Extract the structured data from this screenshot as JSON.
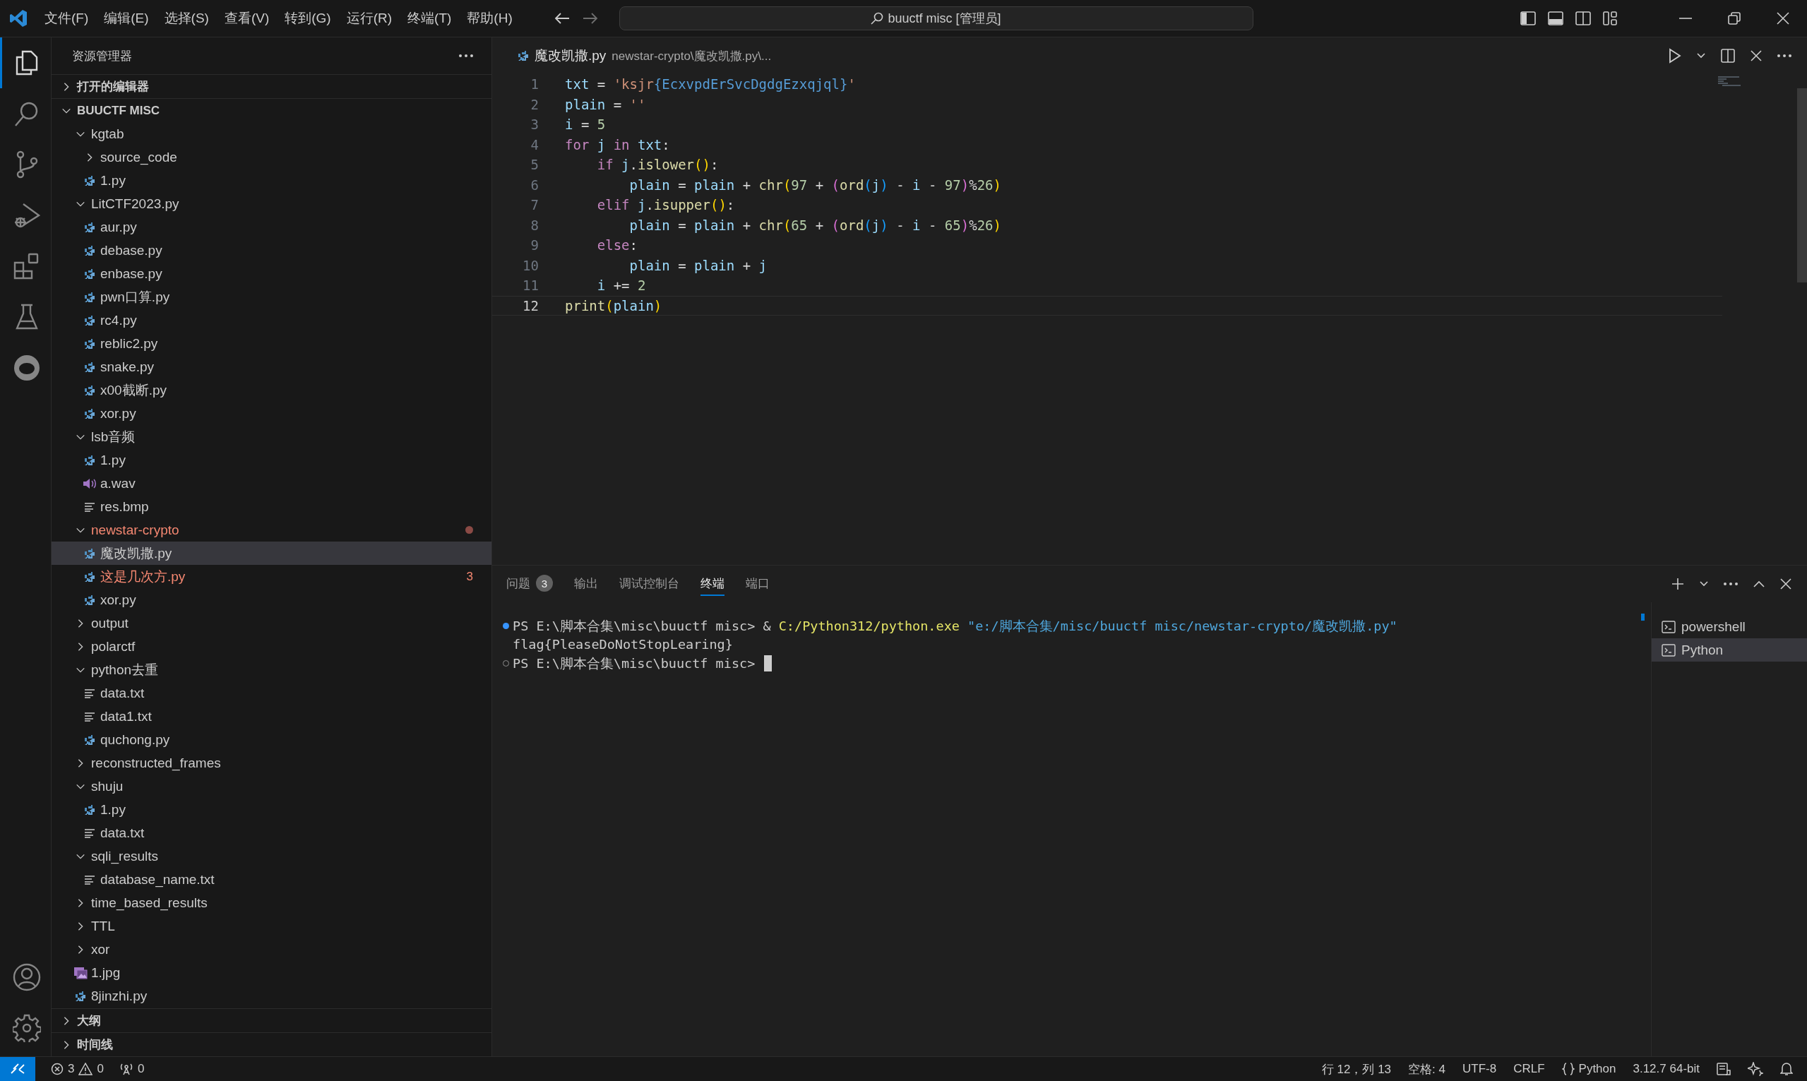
{
  "title_bar": {
    "menus": [
      "文件(F)",
      "编辑(E)",
      "选择(S)",
      "查看(V)",
      "转到(G)",
      "运行(R)",
      "终端(T)",
      "帮助(H)"
    ],
    "search": "buuctf misc [管理员]"
  },
  "activity_bar": {
    "items": [
      {
        "kind": "explorer",
        "selected": true
      },
      {
        "kind": "search",
        "selected": false
      },
      {
        "kind": "source-control",
        "selected": false
      },
      {
        "kind": "run-debug",
        "selected": false
      },
      {
        "kind": "extensions",
        "selected": false
      },
      {
        "kind": "testing",
        "selected": false
      },
      {
        "kind": "extension-logo",
        "selected": false
      }
    ],
    "bottom": [
      {
        "kind": "account"
      },
      {
        "kind": "settings"
      }
    ]
  },
  "sidebar": {
    "title": "资源管理器",
    "sections": [
      {
        "label": "打开的编辑器",
        "expanded": false
      },
      {
        "label": "BUUCTF MISC",
        "expanded": true,
        "tree": [
          {
            "name": "kgtab",
            "kind": "folder",
            "expanded": true,
            "selected": false,
            "error": false,
            "children": [
              {
                "name": "source_code",
                "kind": "folder",
                "expanded": false,
                "selected": false,
                "error": false
              },
              {
                "name": "1.py",
                "kind": "python",
                "selected": false,
                "error": false
              }
            ]
          },
          {
            "name": "LitCTF2023.py",
            "kind": "folder",
            "expanded": true,
            "selected": false,
            "error": false,
            "children": [
              {
                "name": "aur.py",
                "kind": "python",
                "selected": false,
                "error": false
              },
              {
                "name": "debase.py",
                "kind": "python",
                "selected": false,
                "error": false
              },
              {
                "name": "enbase.py",
                "kind": "python",
                "selected": false,
                "error": false
              },
              {
                "name": "pwn口算.py",
                "kind": "python",
                "selected": false,
                "error": false
              },
              {
                "name": "rc4.py",
                "kind": "python",
                "selected": false,
                "error": false
              },
              {
                "name": "reblic2.py",
                "kind": "python",
                "selected": false,
                "error": false
              },
              {
                "name": "snake.py",
                "kind": "python",
                "selected": false,
                "error": false
              },
              {
                "name": "x00截断.py",
                "kind": "python",
                "selected": false,
                "error": false
              },
              {
                "name": "xor.py",
                "kind": "python",
                "selected": false,
                "error": false
              }
            ]
          },
          {
            "name": "lsb音频",
            "kind": "folder",
            "expanded": true,
            "selected": false,
            "error": false,
            "children": [
              {
                "name": "1.py",
                "kind": "python",
                "selected": false,
                "error": false
              },
              {
                "name": "a.wav",
                "kind": "audio",
                "selected": false,
                "error": false
              },
              {
                "name": "res.bmp",
                "kind": "text",
                "selected": false,
                "error": false
              }
            ]
          },
          {
            "name": "newstar-crypto",
            "kind": "folder",
            "expanded": true,
            "selected": false,
            "error": true,
            "children": [
              {
                "name": "魔改凯撒.py",
                "kind": "python",
                "selected": true,
                "error": false
              },
              {
                "name": "这是几次方.py",
                "kind": "python",
                "selected": false,
                "error": true,
                "problems": "3"
              },
              {
                "name": "xor.py",
                "kind": "python",
                "selected": false,
                "error": false
              }
            ]
          },
          {
            "name": "output",
            "kind": "folder",
            "expanded": false,
            "selected": false,
            "error": false
          },
          {
            "name": "polarctf",
            "kind": "folder",
            "expanded": false,
            "selected": false,
            "error": false
          },
          {
            "name": "python去重",
            "kind": "folder",
            "expanded": true,
            "selected": false,
            "error": false,
            "children": [
              {
                "name": "data.txt",
                "kind": "text",
                "selected": false,
                "error": false
              },
              {
                "name": "data1.txt",
                "kind": "text",
                "selected": false,
                "error": false
              },
              {
                "name": "quchong.py",
                "kind": "python",
                "selected": false,
                "error": false
              }
            ]
          },
          {
            "name": "reconstructed_frames",
            "kind": "folder",
            "expanded": false,
            "selected": false,
            "error": false
          },
          {
            "name": "shuju",
            "kind": "folder",
            "expanded": true,
            "selected": false,
            "error": false,
            "children": [
              {
                "name": "1.py",
                "kind": "python",
                "selected": false,
                "error": false
              },
              {
                "name": "data.txt",
                "kind": "text",
                "selected": false,
                "error": false
              }
            ]
          },
          {
            "name": "sqli_results",
            "kind": "folder",
            "expanded": true,
            "selected": false,
            "error": false,
            "children": [
              {
                "name": "database_name.txt",
                "kind": "text",
                "selected": false,
                "error": false
              }
            ]
          },
          {
            "name": "time_based_results",
            "kind": "folder",
            "expanded": false,
            "selected": false,
            "error": false
          },
          {
            "name": "TTL",
            "kind": "folder",
            "expanded": false,
            "selected": false,
            "error": false
          },
          {
            "name": "xor",
            "kind": "folder",
            "expanded": false,
            "selected": false,
            "error": false
          },
          {
            "name": "1.jpg",
            "kind": "image",
            "selected": false,
            "error": false
          },
          {
            "name": "8jinzhi.py",
            "kind": "python",
            "selected": false,
            "error": false
          }
        ]
      },
      {
        "label": "大纲",
        "expanded": false
      },
      {
        "label": "时间线",
        "expanded": false
      }
    ]
  },
  "editor": {
    "tab": {
      "file": "魔改凯撒.py",
      "path": "newstar-crypto\\魔改凯撒.py\\..."
    },
    "lines": [
      {
        "number": "1",
        "current": false,
        "tokens": [
          {
            "text": "txt",
            "kind": "var"
          },
          {
            "text": " = ",
            "kind": "op"
          },
          {
            "text": "'ksjr",
            "kind": "str"
          },
          {
            "text": "{EcxvpdErSvcDgdgEzxqjql}",
            "kind": "interp"
          },
          {
            "text": "'",
            "kind": "str"
          }
        ]
      },
      {
        "number": "2",
        "current": false,
        "tokens": [
          {
            "text": "plain",
            "kind": "var"
          },
          {
            "text": " = ",
            "kind": "op"
          },
          {
            "text": "''",
            "kind": "str"
          }
        ]
      },
      {
        "number": "3",
        "current": false,
        "tokens": [
          {
            "text": "i",
            "kind": "var"
          },
          {
            "text": " = ",
            "kind": "op"
          },
          {
            "text": "5",
            "kind": "num"
          }
        ]
      },
      {
        "number": "4",
        "current": false,
        "tokens": [
          {
            "text": "for",
            "kind": "kw"
          },
          {
            "text": " j",
            "kind": "var"
          },
          {
            "text": " in",
            "kind": "kw"
          },
          {
            "text": " txt",
            "kind": "var"
          },
          {
            "text": ":",
            "kind": "op"
          }
        ]
      },
      {
        "number": "5",
        "current": false,
        "tokens": [
          {
            "text": "    if",
            "kind": "kw"
          },
          {
            "text": " j",
            "kind": "var"
          },
          {
            "text": ".",
            "kind": "op"
          },
          {
            "text": "islower",
            "kind": "func"
          },
          {
            "text": "()",
            "kind": "p1"
          },
          {
            "text": ":",
            "kind": "op"
          }
        ]
      },
      {
        "number": "6",
        "current": false,
        "tokens": [
          {
            "text": "        plain",
            "kind": "var"
          },
          {
            "text": " = ",
            "kind": "op"
          },
          {
            "text": "plain",
            "kind": "var"
          },
          {
            "text": " + ",
            "kind": "op"
          },
          {
            "text": "chr",
            "kind": "func"
          },
          {
            "text": "(",
            "kind": "p1"
          },
          {
            "text": "97",
            "kind": "num"
          },
          {
            "text": " + ",
            "kind": "op"
          },
          {
            "text": "(",
            "kind": "p2"
          },
          {
            "text": "ord",
            "kind": "func"
          },
          {
            "text": "(",
            "kind": "p3"
          },
          {
            "text": "j",
            "kind": "var"
          },
          {
            "text": ")",
            "kind": "p3"
          },
          {
            "text": " - ",
            "kind": "op"
          },
          {
            "text": "i",
            "kind": "var"
          },
          {
            "text": " - ",
            "kind": "op"
          },
          {
            "text": "97",
            "kind": "num"
          },
          {
            "text": ")",
            "kind": "p2"
          },
          {
            "text": "%",
            "kind": "op"
          },
          {
            "text": "26",
            "kind": "num"
          },
          {
            "text": ")",
            "kind": "p1"
          }
        ]
      },
      {
        "number": "7",
        "current": false,
        "tokens": [
          {
            "text": "    elif",
            "kind": "kw"
          },
          {
            "text": " j",
            "kind": "var"
          },
          {
            "text": ".",
            "kind": "op"
          },
          {
            "text": "isupper",
            "kind": "func"
          },
          {
            "text": "()",
            "kind": "p1"
          },
          {
            "text": ":",
            "kind": "op"
          }
        ]
      },
      {
        "number": "8",
        "current": false,
        "tokens": [
          {
            "text": "        plain",
            "kind": "var"
          },
          {
            "text": " = ",
            "kind": "op"
          },
          {
            "text": "plain",
            "kind": "var"
          },
          {
            "text": " + ",
            "kind": "op"
          },
          {
            "text": "chr",
            "kind": "func"
          },
          {
            "text": "(",
            "kind": "p1"
          },
          {
            "text": "65",
            "kind": "num"
          },
          {
            "text": " + ",
            "kind": "op"
          },
          {
            "text": "(",
            "kind": "p2"
          },
          {
            "text": "ord",
            "kind": "func"
          },
          {
            "text": "(",
            "kind": "p3"
          },
          {
            "text": "j",
            "kind": "var"
          },
          {
            "text": ")",
            "kind": "p3"
          },
          {
            "text": " - ",
            "kind": "op"
          },
          {
            "text": "i",
            "kind": "var"
          },
          {
            "text": " - ",
            "kind": "op"
          },
          {
            "text": "65",
            "kind": "num"
          },
          {
            "text": ")",
            "kind": "p2"
          },
          {
            "text": "%",
            "kind": "op"
          },
          {
            "text": "26",
            "kind": "num"
          },
          {
            "text": ")",
            "kind": "p1"
          }
        ]
      },
      {
        "number": "9",
        "current": false,
        "tokens": [
          {
            "text": "    else",
            "kind": "kw"
          },
          {
            "text": ":",
            "kind": "op"
          }
        ]
      },
      {
        "number": "10",
        "current": false,
        "tokens": [
          {
            "text": "        plain",
            "kind": "var"
          },
          {
            "text": " = ",
            "kind": "op"
          },
          {
            "text": "plain",
            "kind": "var"
          },
          {
            "text": " + ",
            "kind": "op"
          },
          {
            "text": "j",
            "kind": "var"
          }
        ]
      },
      {
        "number": "11",
        "current": false,
        "tokens": [
          {
            "text": "    i",
            "kind": "var"
          },
          {
            "text": " += ",
            "kind": "op"
          },
          {
            "text": "2",
            "kind": "num"
          }
        ]
      },
      {
        "number": "12",
        "current": true,
        "tokens": [
          {
            "text": "print",
            "kind": "func"
          },
          {
            "text": "(",
            "kind": "p1"
          },
          {
            "text": "plain",
            "kind": "var"
          },
          {
            "text": ")",
            "kind": "p1"
          }
        ]
      }
    ]
  },
  "panel": {
    "tabs": [
      {
        "label": "问题",
        "badge": "3",
        "selected": false
      },
      {
        "label": "输出",
        "selected": false
      },
      {
        "label": "调试控制台",
        "selected": false
      },
      {
        "label": "终端",
        "selected": true
      },
      {
        "label": "端口",
        "selected": false
      }
    ],
    "terminal": {
      "lines": [
        {
          "kind": "command",
          "succeeded": true,
          "cursor": false,
          "segments": [
            {
              "text": "PS E:\\脚本合集\\misc\\buuctf misc> & ",
              "kind": "plain"
            },
            {
              "text": "C:/Python312/python.exe",
              "kind": "exe"
            },
            {
              "text": " \"e:/脚本合集/misc/buuctf misc/newstar-crypto/魔改凯撒.py\"",
              "kind": "path"
            }
          ]
        },
        {
          "kind": "output",
          "cursor": false,
          "segments": [
            {
              "text": "flag{PleaseDoNotStopLearing}",
              "kind": "plain"
            }
          ]
        },
        {
          "kind": "command",
          "succeeded": false,
          "cursor": true,
          "segments": [
            {
              "text": "PS E:\\脚本合集\\misc\\buuctf misc>",
              "kind": "plain"
            }
          ]
        }
      ]
    },
    "terminals": [
      {
        "name": "powershell",
        "selected": false
      },
      {
        "name": "Python",
        "selected": true
      }
    ]
  },
  "status_bar": {
    "errors": "3",
    "warnings": "0",
    "ports": "0",
    "right": [
      {
        "text": "行 12，列 13",
        "kind": "plain"
      },
      {
        "text": "空格: 4",
        "kind": "plain"
      },
      {
        "text": "UTF-8",
        "kind": "plain"
      },
      {
        "text": "CRLF",
        "kind": "plain"
      },
      {
        "text": "Python",
        "kind": "language"
      },
      {
        "text": "3.12.7 64-bit",
        "kind": "plain"
      }
    ]
  }
}
